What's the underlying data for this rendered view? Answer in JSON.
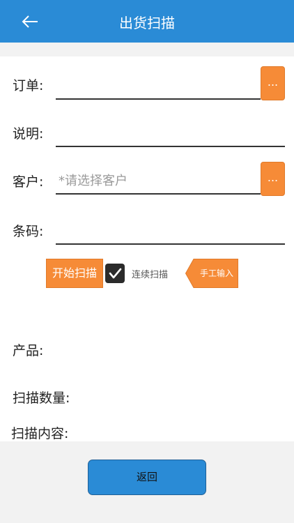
{
  "header": {
    "title": "出货扫描",
    "back_icon": "arrow-left-icon"
  },
  "form": {
    "order": {
      "label": "订单:",
      "value": "",
      "more": "..."
    },
    "description": {
      "label": "说明:",
      "value": ""
    },
    "customer": {
      "label": "客户:",
      "placeholder": "*请选择客户",
      "more": "..."
    },
    "barcode": {
      "label": "条码:",
      "value": ""
    }
  },
  "scan": {
    "start_label": "开始扫描",
    "continuous_label": "连续扫描",
    "continuous_checked": true,
    "manual_label": "手工输入"
  },
  "info": {
    "product_label": "产品:",
    "scan_qty_label": "扫描数量:",
    "scan_content_label": "扫描内容:"
  },
  "footer": {
    "return_label": "返回"
  },
  "colors": {
    "header": "#2a8bd6",
    "accent": "#f68b37",
    "button": "#2a8bd6"
  }
}
